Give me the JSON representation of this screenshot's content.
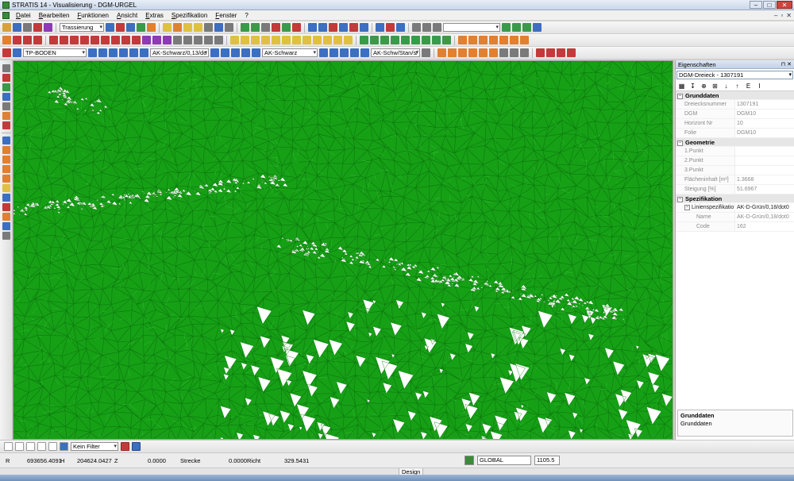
{
  "window": {
    "title": "STRATIS 14 - Visualisierung - DGM-URGEL",
    "buttons": {
      "minimize": "–",
      "maximize": "□",
      "close": "✕"
    }
  },
  "menu": {
    "items": [
      "Datei",
      "Bearbeiten",
      "Funktionen",
      "Ansicht",
      "Extras",
      "Spezifikation",
      "Fenster",
      "?"
    ],
    "mdi": {
      "minimize": "–",
      "restore": "▫",
      "close": "✕"
    }
  },
  "toolbar": {
    "trassierung": "Trassierung",
    "layer": "TP-BODEN",
    "line_spec": "AK-Schwarz/0,13/do",
    "color": "AK-Schwarz",
    "line_type": "AK-Schw/Stan/s/"
  },
  "properties": {
    "title": "Eigenschaften",
    "selection": "DGM-Dreieck - 1307191",
    "tools": [
      "↓",
      "↑",
      "E",
      "I"
    ],
    "sections": [
      {
        "name": "Grunddaten",
        "rows": [
          {
            "key": "Dreiecksnummer",
            "value": "1307191"
          },
          {
            "key": "DGM",
            "value": "DGM10"
          },
          {
            "key": "Horizont Nr",
            "value": "10"
          },
          {
            "key": "Folie",
            "value": "DGM10"
          }
        ]
      },
      {
        "name": "Geometrie",
        "rows": [
          {
            "key": "1.Punkt",
            "value": ""
          },
          {
            "key": "2.Punkt",
            "value": ""
          },
          {
            "key": "3.Punkt",
            "value": ""
          },
          {
            "key": "Flächeninhalt [m²]",
            "value": "1.3668"
          },
          {
            "key": "Steigung [%]",
            "value": "51.6967"
          }
        ]
      },
      {
        "name": "Spezifikation",
        "group": {
          "key": "Linienspezifikatio",
          "value": "AK-D-Grün/0,18/dot0"
        },
        "rows": [
          {
            "key": "Name",
            "value": "AK-D-Grün/0,18/dot0"
          },
          {
            "key": "Code",
            "value": "162"
          }
        ]
      }
    ],
    "description": {
      "heading": "Grunddaten",
      "text": "Grunddaten"
    }
  },
  "filter": {
    "label": "Kein Filter"
  },
  "status": {
    "r_label": "R",
    "r_value": "693656.4091",
    "h_label": "H",
    "h_value": "204624.0427",
    "z_label": "Z",
    "z_value": "0.0000",
    "strecke_label": "Strecke",
    "strecke_value": "0.0000",
    "richt_label": "Richt",
    "richt_value": "329.5431",
    "coord_system": "GLOBAL",
    "scale": "1105.5"
  },
  "design_tab": "Design",
  "colors": {
    "mesh_fill": "#16a016",
    "mesh_line": "#0d7a0d",
    "gap": "#ffffff"
  }
}
